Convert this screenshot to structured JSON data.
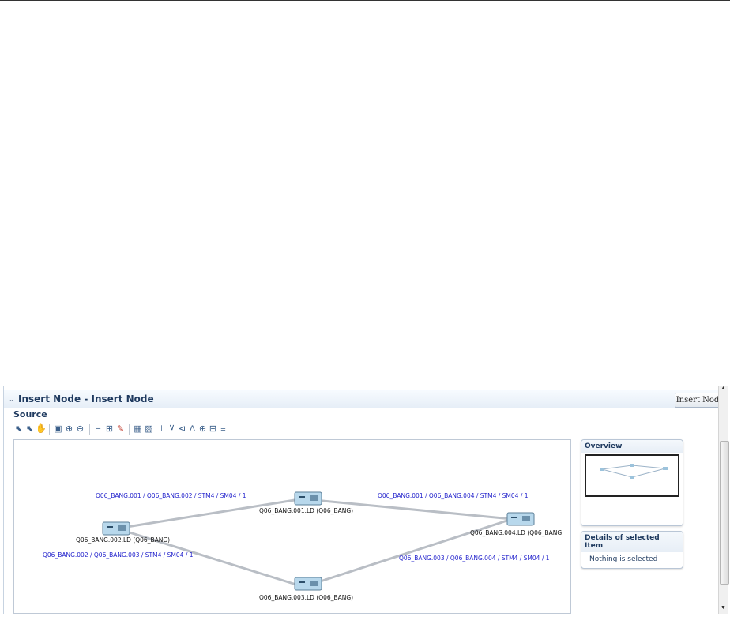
{
  "panel": {
    "title": "Insert Node - Insert Node",
    "insert_button_label": "Insert Node",
    "source_label": "Source"
  },
  "toolbar": {
    "icons": [
      "select-icon",
      "select-plus-icon",
      "pan-hand-icon",
      "fit-to-window-icon",
      "zoom-in-icon",
      "zoom-out-icon",
      "link-icon",
      "add-node-icon",
      "edit-pencil-icon",
      "layout-grid-icon",
      "layout-tree-icon",
      "layout-hierarchical-icon",
      "layout-circle-icon",
      "layout-radial-icon",
      "layout-symmetric-icon",
      "layout-cluster-icon",
      "layout-table-icon"
    ]
  },
  "diagram": {
    "nodes": [
      {
        "id": "n1",
        "label": "Q06_BANG.001.LD (Q06_BANG)"
      },
      {
        "id": "n2",
        "label": "Q06_BANG.002.LD (Q06_BANG)"
      },
      {
        "id": "n3",
        "label": "Q06_BANG.003.LD (Q06_BANG)"
      },
      {
        "id": "n4",
        "label": "Q06_BANG.004.LD (Q06_BANG"
      }
    ],
    "links": [
      {
        "from": "n2",
        "to": "n1",
        "label": "Q06_BANG.001 / Q06_BANG.002 / STM4 / SM04 / 1"
      },
      {
        "from": "n1",
        "to": "n4",
        "label": "Q06_BANG.001 / Q06_BANG.004 / STM4 / SM04 / 1"
      },
      {
        "from": "n2",
        "to": "n3",
        "label": "Q06_BANG.002 / Q06_BANG.003 / STM4 / SM04 / 1"
      },
      {
        "from": "n3",
        "to": "n4",
        "label": "Q06_BANG.003 / Q06_BANG.004 / STM4 / SM04 / 1"
      }
    ]
  },
  "overview": {
    "title": "Overview"
  },
  "details": {
    "title": "Details of selected Item",
    "empty_text": "Nothing is selected"
  },
  "colors": {
    "link_label": "#2222cc",
    "link_line": "#b9bec5",
    "node_body": "#b8d8ec",
    "header_text": "#1f3a5f"
  }
}
